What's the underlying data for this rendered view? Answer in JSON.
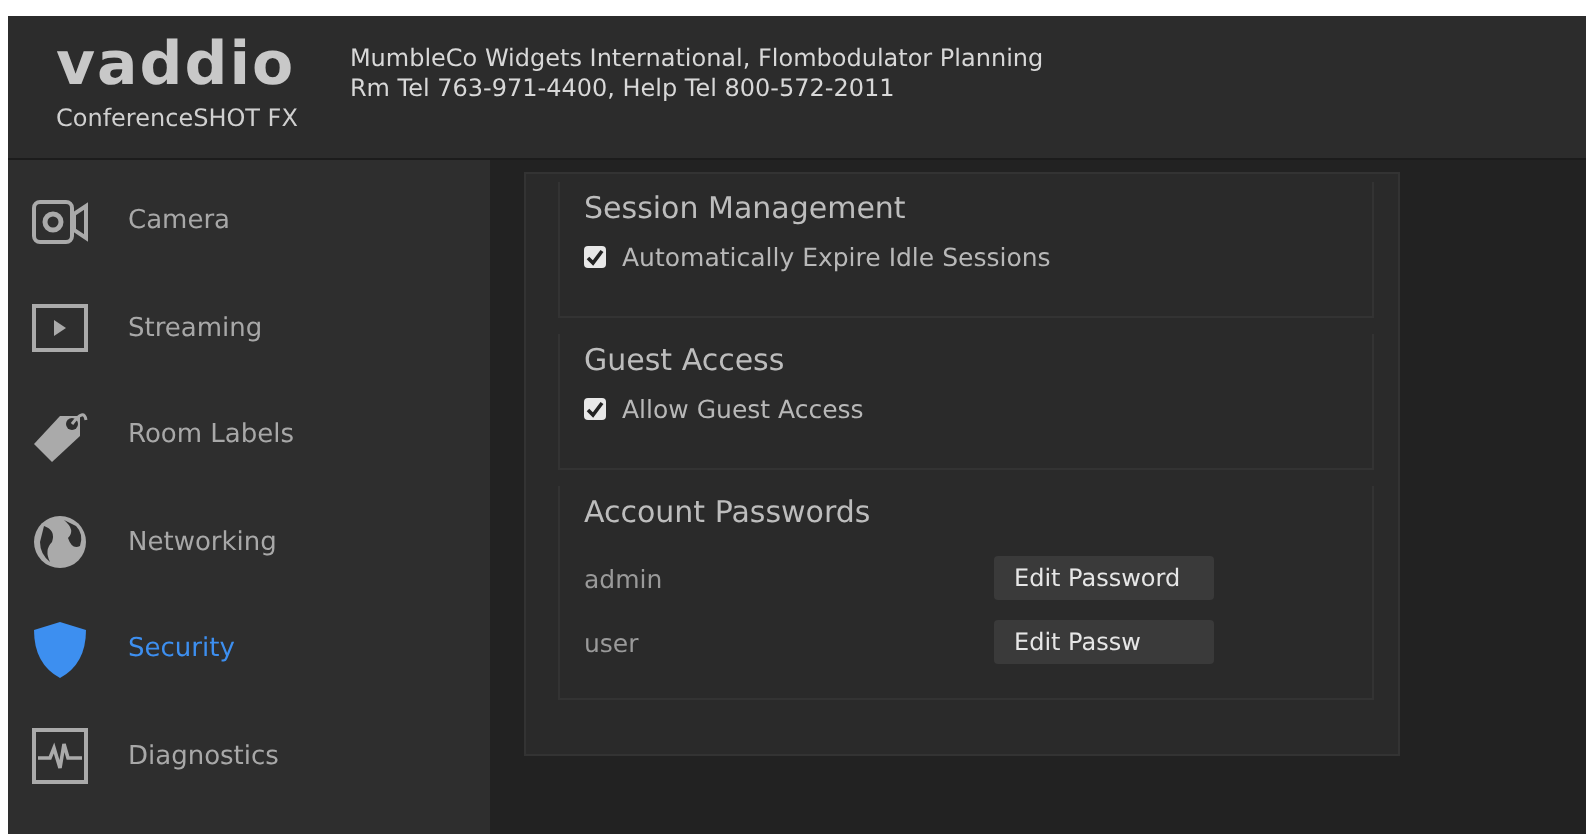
{
  "header": {
    "logo": "vaddio",
    "product": "ConferenceSHOT FX",
    "org": "MumbleCo Widgets International, Flombodulator Planning",
    "phones": "Rm Tel 763-971-4400, Help Tel 800-572-2011"
  },
  "sidebar": {
    "items": [
      {
        "label": "Camera",
        "kind": "camera",
        "selected": false
      },
      {
        "label": "Streaming",
        "kind": "streaming",
        "selected": false
      },
      {
        "label": "Room Labels",
        "kind": "tag",
        "selected": false
      },
      {
        "label": "Networking",
        "kind": "globe",
        "selected": false
      },
      {
        "label": "Security",
        "kind": "shield",
        "selected": true
      },
      {
        "label": "Diagnostics",
        "kind": "pulse",
        "selected": false
      }
    ]
  },
  "sections": [
    {
      "title": "Session Management",
      "kind": "checkbox",
      "checked": true,
      "label": "Automatically Expire Idle Sessions"
    },
    {
      "title": "Guest Access",
      "kind": "checkbox",
      "checked": true,
      "label": "Allow Guest Access"
    },
    {
      "title": "Account Passwords",
      "kind": "accounts",
      "accounts": [
        {
          "user": "admin",
          "button": "Edit Password"
        },
        {
          "user": "user",
          "button": "Edit Passw"
        }
      ]
    }
  ]
}
